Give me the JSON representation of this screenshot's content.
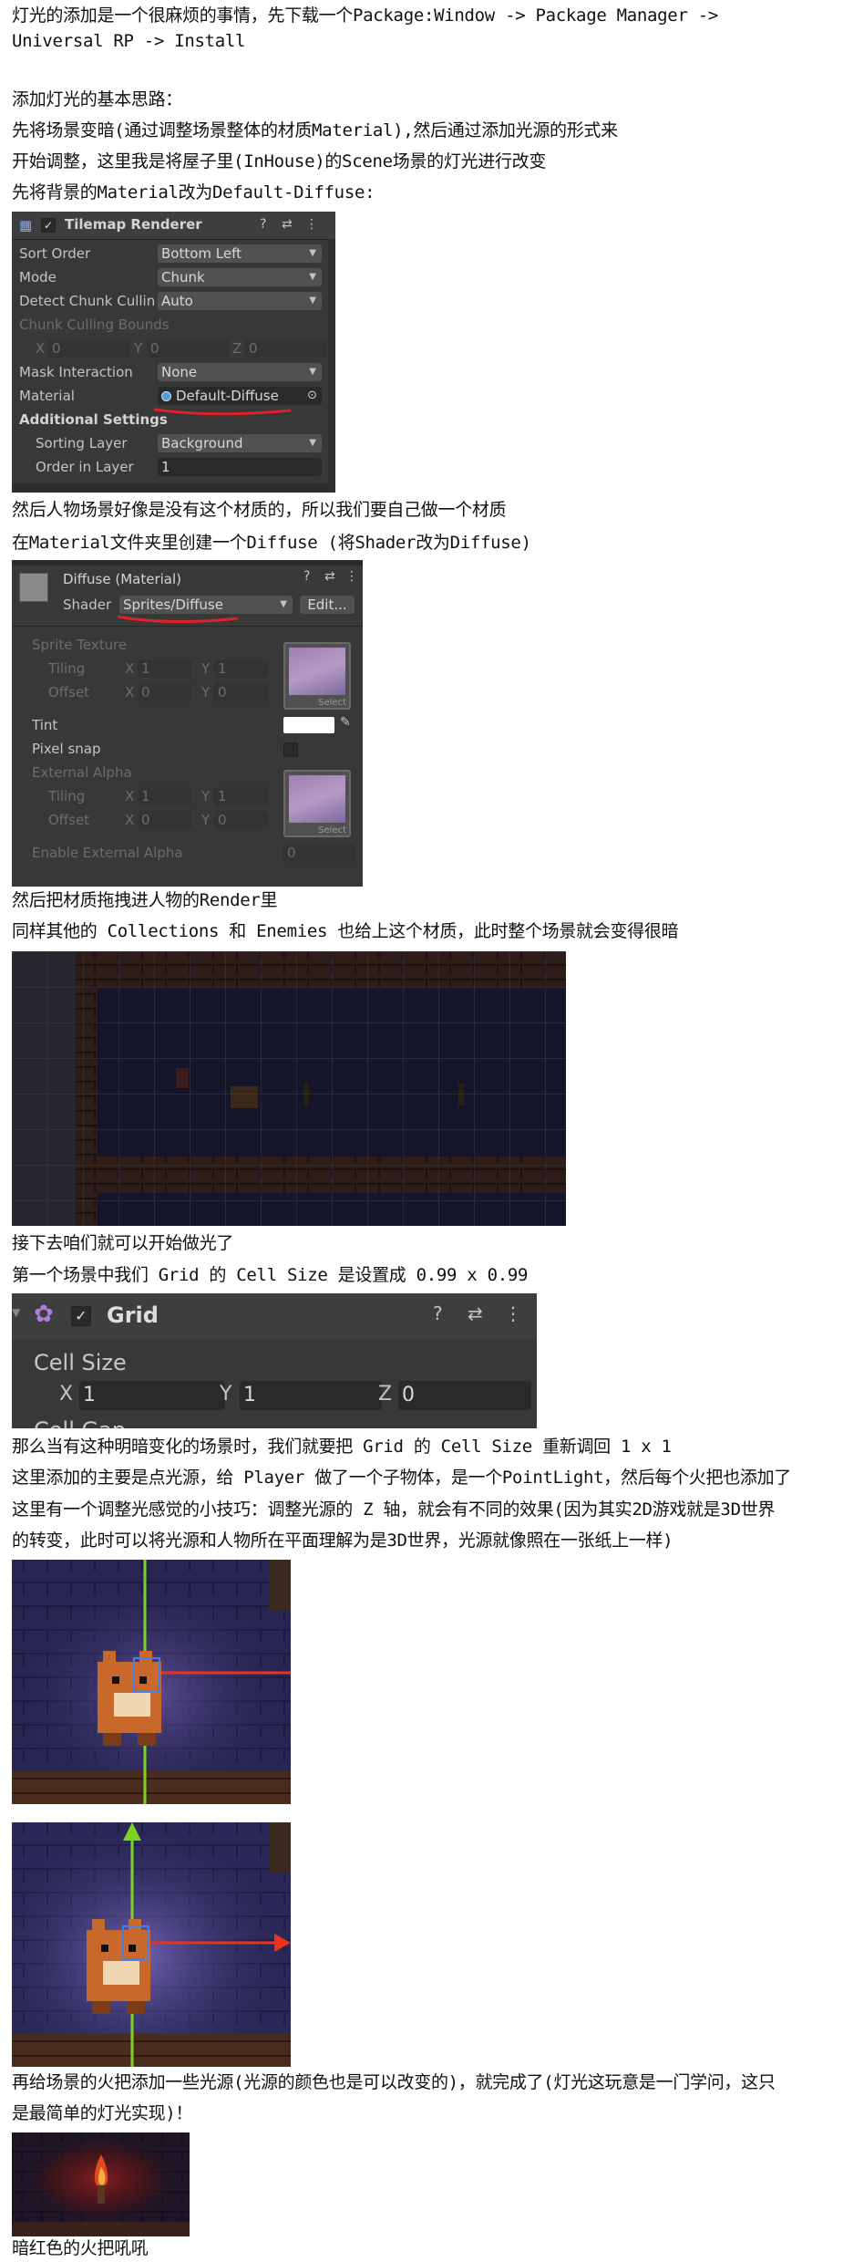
{
  "paragraphs": {
    "p1": "灯光的添加是一个很麻烦的事情，先下载一个Package:Window -> Package Manager ->",
    "p1b": "Universal RP -> Install",
    "p2": "添加灯光的基本思路：",
    "p3": "先将场景变暗(通过调整场景整体的材质Material),然后通过添加光源的形式来",
    "p4": "开始调整，这里我是将屋子里(InHouse)的Scene场景的灯光进行改变",
    "p5": "先将背景的Material改为Default-Diffuse:",
    "p6": "然后人物场景好像是没有这个材质的，所以我们要自己做一个材质",
    "p7": "在Material文件夹里创建一个Diffuse (将Shader改为Diffuse)",
    "p8": "然后把材质拖拽进人物的Render里",
    "p9": "同样其他的 Collections 和 Enemies 也给上这个材质，此时整个场景就会变得很暗",
    "p10": "接下去咱们就可以开始做光了",
    "p11": "第一个场景中我们 Grid 的 Cell Size 是设置成 0.99 x 0.99",
    "p12": "那么当有这种明暗变化的场景时，我们就要把 Grid 的 Cell Size 重新调回 1 x 1",
    "p13": "这里添加的主要是点光源，给 Player 做了一个子物体，是一个PointLight，然后每个火把也添加了",
    "p14": "这里有一个调整光感觉的小技巧：调整光源的 Z 轴，就会有不同的效果(因为其实2D游戏就是3D世界",
    "p15": "的转变，此时可以将光源和人物所在平面理解为是3D世界，光源就像照在一张纸上一样)",
    "p16": "再给场景的火把添加一些光源(光源的颜色也是可以改变的)，就完成了(灯光这玩意是一门学问，这只",
    "p17": "是最简单的灯光实现)！",
    "p18": "暗红色的火把吼吼"
  },
  "tilemap_renderer": {
    "title": "Tilemap Renderer",
    "sort_order_label": "Sort Order",
    "sort_order_value": "Bottom Left",
    "mode_label": "Mode",
    "mode_value": "Chunk",
    "detect_label": "Detect Chunk Culling",
    "detect_value": "Auto",
    "bounds_label": "Chunk Culling Bounds",
    "x_label": "X",
    "x_value": "0",
    "y_label": "Y",
    "y_value": "0",
    "z_label": "Z",
    "z_value": "0",
    "mask_label": "Mask Interaction",
    "mask_value": "None",
    "material_label": "Material",
    "material_value": "Default-Diffuse",
    "additional_label": "Additional Settings",
    "sorting_layer_label": "Sorting Layer",
    "sorting_layer_value": "Background",
    "order_label": "Order in Layer",
    "order_value": "1"
  },
  "diffuse_material": {
    "title": "Diffuse (Material)",
    "shader_label": "Shader",
    "shader_value": "Sprites/Diffuse",
    "edit_label": "Edit...",
    "sprite_texture_label": "Sprite Texture",
    "tiling_label": "Tiling",
    "offset_label": "Offset",
    "tiling_x": "1",
    "tiling_y": "1",
    "offset_x": "0",
    "offset_y": "0",
    "select_label": "Select",
    "tint_label": "Tint",
    "pixel_snap_label": "Pixel snap",
    "external_alpha_label": "External Alpha",
    "tiling2_x": "1",
    "tiling2_y": "1",
    "offset2_x": "0",
    "offset2_y": "0",
    "enable_ext_label": "Enable External Alpha",
    "enable_ext_value": "0",
    "x_label": "X",
    "y_label": "Y"
  },
  "grid_component": {
    "title": "Grid",
    "cell_size_label": "Cell Size",
    "x_label": "X",
    "x_value": "1",
    "y_label": "Y",
    "y_value": "1",
    "z_label": "Z",
    "z_value": "0",
    "cell_gap_label": "Cell Gap"
  },
  "colors": {
    "inspector_bg": "#383838",
    "annotation_red": "#e0202a",
    "scene_dark": "#1b1a2c",
    "gizmo_green": "#7ed321",
    "gizmo_red": "#e8331f"
  }
}
